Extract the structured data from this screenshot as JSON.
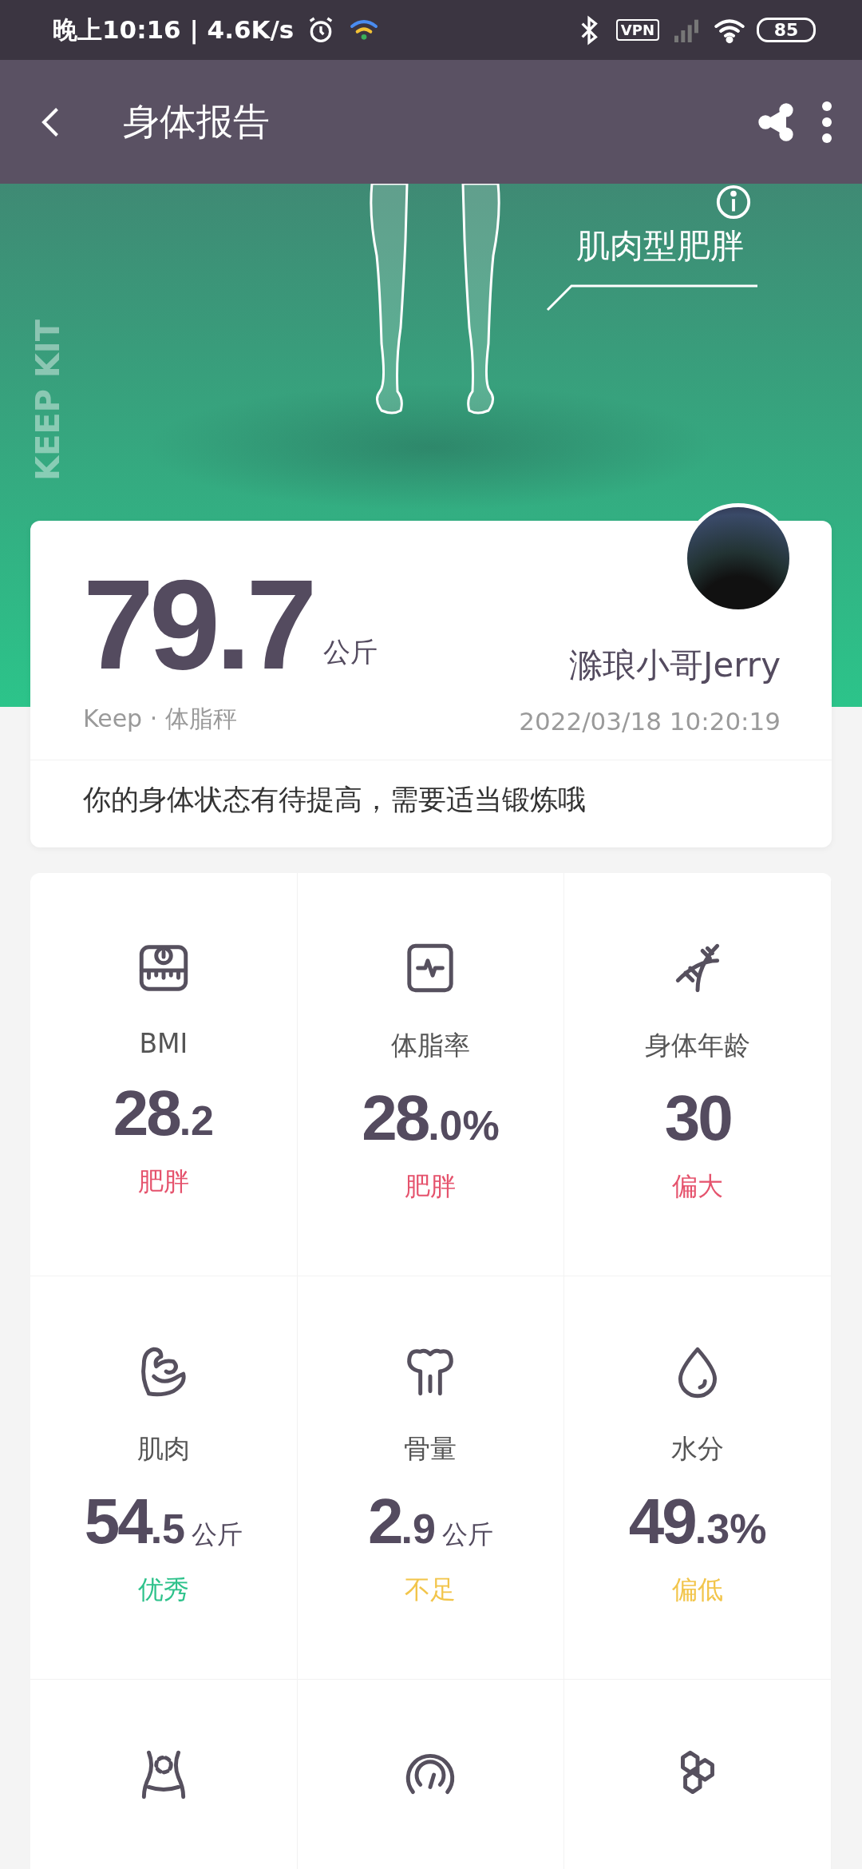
{
  "status_bar": {
    "time": "晚上10:16 | 4.6K/s",
    "vpn": "VPN",
    "battery": "85"
  },
  "app_bar": {
    "title": "身体报告"
  },
  "hero": {
    "side_text": "KEEP KIT",
    "body_type": "肌肉型肥胖"
  },
  "summary": {
    "weight": "79.7",
    "unit": "公斤",
    "source": "Keep · 体脂秤",
    "user": "滁琅小哥Jerry",
    "time": "2022/03/18 10:20:19",
    "message": "你的身体状态有待提高，需要适当锻炼哦"
  },
  "metrics": [
    {
      "label": "BMI",
      "whole": "28",
      "fraction": ".2",
      "status": "肥胖",
      "color": "#e5536d"
    },
    {
      "label": "体脂率",
      "whole": "28",
      "fraction": ".0%",
      "status": "肥胖",
      "color": "#e5536d"
    },
    {
      "label": "身体年龄",
      "whole": "30",
      "status": "偏大",
      "color": "#e5536d"
    },
    {
      "label": "肌肉",
      "whole": "54",
      "fraction": ".5",
      "unit": "公斤",
      "status": "优秀",
      "color": "#2ec28b"
    },
    {
      "label": "骨量",
      "whole": "2",
      "fraction": ".9",
      "unit": "公斤",
      "status": "不足",
      "color": "#f2c54b"
    },
    {
      "label": "水分",
      "whole": "49",
      "fraction": ".3%",
      "status": "偏低",
      "color": "#f2c54b"
    }
  ]
}
